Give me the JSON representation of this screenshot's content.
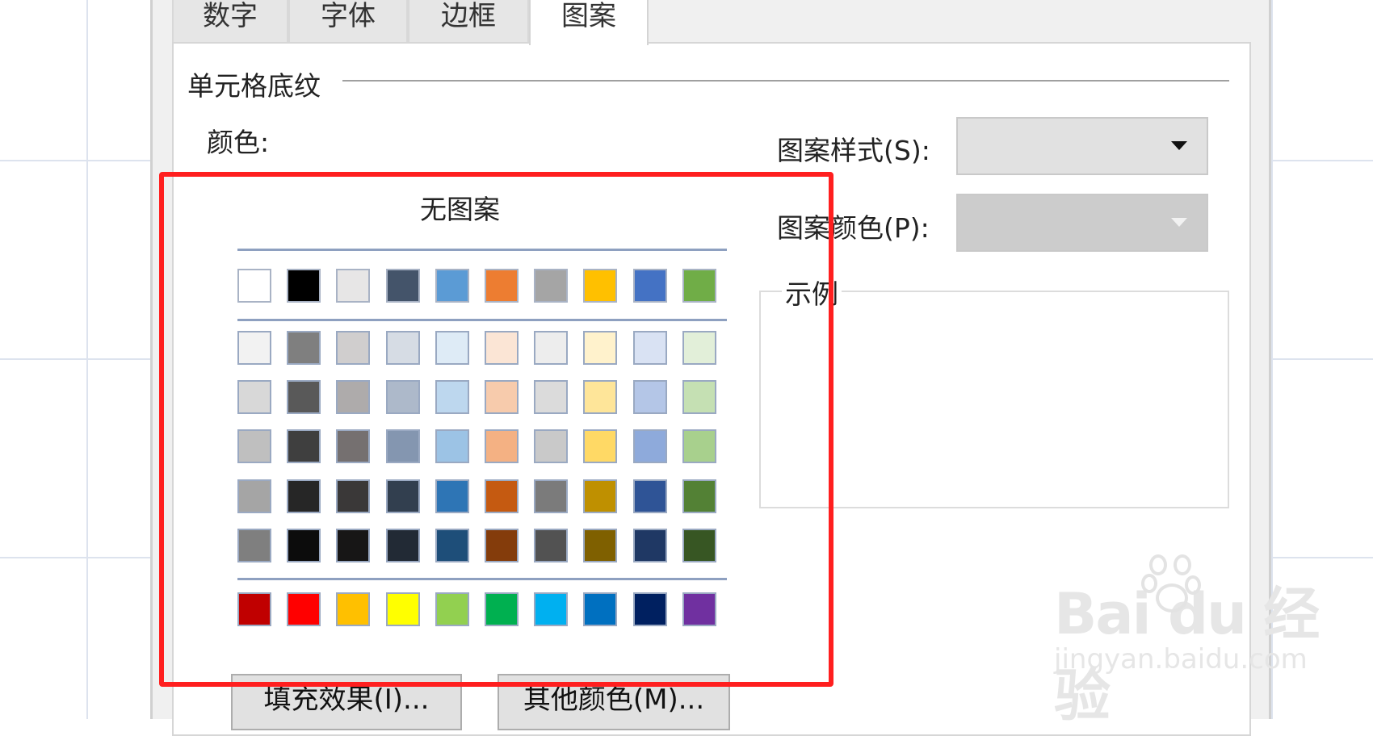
{
  "tabs": [
    {
      "label": "数字",
      "active": false
    },
    {
      "label": "字体",
      "active": false
    },
    {
      "label": "边框",
      "active": false
    },
    {
      "label": "图案",
      "active": true
    }
  ],
  "shading": {
    "section_title": "单元格底纹",
    "color_label": "颜色:",
    "no_pattern": "无图案"
  },
  "theme_colors": {
    "base": [
      "#ffffff",
      "#000000",
      "#e7e6e6",
      "#44546a",
      "#5b9bd5",
      "#ed7d31",
      "#a5a5a5",
      "#ffc000",
      "#4472c4",
      "#70ad47"
    ],
    "tints": [
      [
        "#f2f2f2",
        "#7f7f7f",
        "#d0cece",
        "#d6dce4",
        "#deebf6",
        "#fbe5d5",
        "#ededed",
        "#fff2cc",
        "#d9e2f3",
        "#e2efd9"
      ],
      [
        "#d8d8d8",
        "#595959",
        "#aeabab",
        "#adb9ca",
        "#bdd7ee",
        "#f7cbac",
        "#dbdbdb",
        "#fee599",
        "#b4c6e7",
        "#c5e0b3"
      ],
      [
        "#bfbfbf",
        "#3f3f3f",
        "#757070",
        "#8496b0",
        "#9cc3e5",
        "#f4b183",
        "#c9c9c9",
        "#ffd965",
        "#8eaadb",
        "#a8d08d"
      ],
      [
        "#a5a5a5",
        "#262626",
        "#3a3838",
        "#323f4f",
        "#2e75b5",
        "#c55a11",
        "#7b7b7b",
        "#bf9000",
        "#2f5496",
        "#538135"
      ],
      [
        "#7f7f7f",
        "#0c0c0c",
        "#171616",
        "#222a35",
        "#1e4e79",
        "#843c0b",
        "#525252",
        "#7f6000",
        "#1f3864",
        "#375623"
      ]
    ],
    "standard": [
      "#c00000",
      "#ff0000",
      "#ffc000",
      "#ffff00",
      "#92d050",
      "#00b050",
      "#00b0f0",
      "#0070c0",
      "#002060",
      "#7030a0"
    ]
  },
  "buttons": {
    "fill_effects": "填充效果(I)...",
    "more_colors": "其他颜色(M)..."
  },
  "pattern": {
    "style_label": "图案样式(S):",
    "color_label": "图案颜色(P):"
  },
  "sample": {
    "label": "示例"
  },
  "watermark": {
    "main": "Bai  du 经验",
    "sub": "jingyan.baidu.com"
  },
  "colors": {
    "highlight": "#ff1f1f"
  }
}
